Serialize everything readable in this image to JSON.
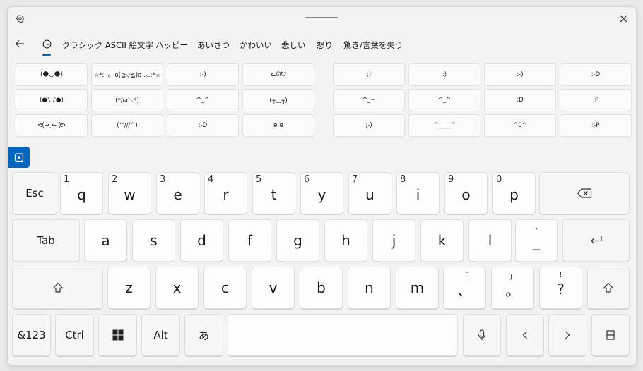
{
  "titlebar": {
    "settings_icon": "gear-icon",
    "close_icon": "close-icon"
  },
  "tabs": {
    "back_icon": "back-arrow-icon",
    "recent_icon": "clock-icon",
    "items": [
      "クラシック ASCII 絵文字",
      "ハッピー",
      "あいさつ",
      "かわいい",
      "悲しい",
      "怒り",
      "驚き/言葉を失う"
    ]
  },
  "kaomoji": {
    "left": [
      [
        "(☻◡☻)",
        "☆*: .｡. o(≧▽≦)o .｡.:*☆",
        ":-)",
        "ᓚᘏᗢ"
      ],
      [
        "(●'◡'●)",
        "(*/ω＼*)",
        "^_^",
        "(╥﹏╥)"
      ],
      [
        "ᕙ(⇀‸↼‶)ᕗ",
        "(^///^)",
        ":-D",
        "ʚ ɞ"
      ]
    ],
    "right": [
      [
        ";)",
        ":)",
        ":-)",
        ":-D"
      ],
      [
        "^_~",
        "^_^",
        ":D",
        ":P"
      ],
      [
        ";-)",
        "^____^",
        "^0^",
        ":-P"
      ]
    ]
  },
  "emoji_panel_icon": "emoji-panel-icon",
  "keyboard": {
    "row1": {
      "esc": "Esc",
      "keys": [
        {
          "hint": "1",
          "label": "q"
        },
        {
          "hint": "2",
          "label": "w"
        },
        {
          "hint": "3",
          "label": "e"
        },
        {
          "hint": "4",
          "label": "r"
        },
        {
          "hint": "5",
          "label": "t"
        },
        {
          "hint": "6",
          "label": "y"
        },
        {
          "hint": "7",
          "label": "u"
        },
        {
          "hint": "8",
          "label": "i"
        },
        {
          "hint": "9",
          "label": "o"
        },
        {
          "hint": "0",
          "label": "p"
        }
      ],
      "backspace_icon": "backspace-icon"
    },
    "row2": {
      "tab": "Tab",
      "keys": [
        "a",
        "s",
        "d",
        "f",
        "g",
        "h",
        "j",
        "k",
        "l"
      ],
      "underscore_sub": "・",
      "underscore": "_",
      "enter_icon": "enter-icon"
    },
    "row3": {
      "shift_icon": "shift-icon",
      "keys": [
        "z",
        "x",
        "c",
        "v",
        "b",
        "n",
        "m"
      ],
      "punct": [
        {
          "sub": "「",
          "label": "、"
        },
        {
          "sub": "」",
          "label": "。"
        },
        {
          "sub": "!",
          "label": "?"
        }
      ]
    },
    "row4": {
      "num": "&123",
      "ctrl": "Ctrl",
      "windows_icon": "windows-icon",
      "alt": "Alt",
      "ime": "あ",
      "mic_icon": "microphone-icon",
      "left_icon": "chevron-left-icon",
      "right_icon": "chevron-right-icon",
      "layout_icon": "keyboard-layout-icon"
    }
  }
}
